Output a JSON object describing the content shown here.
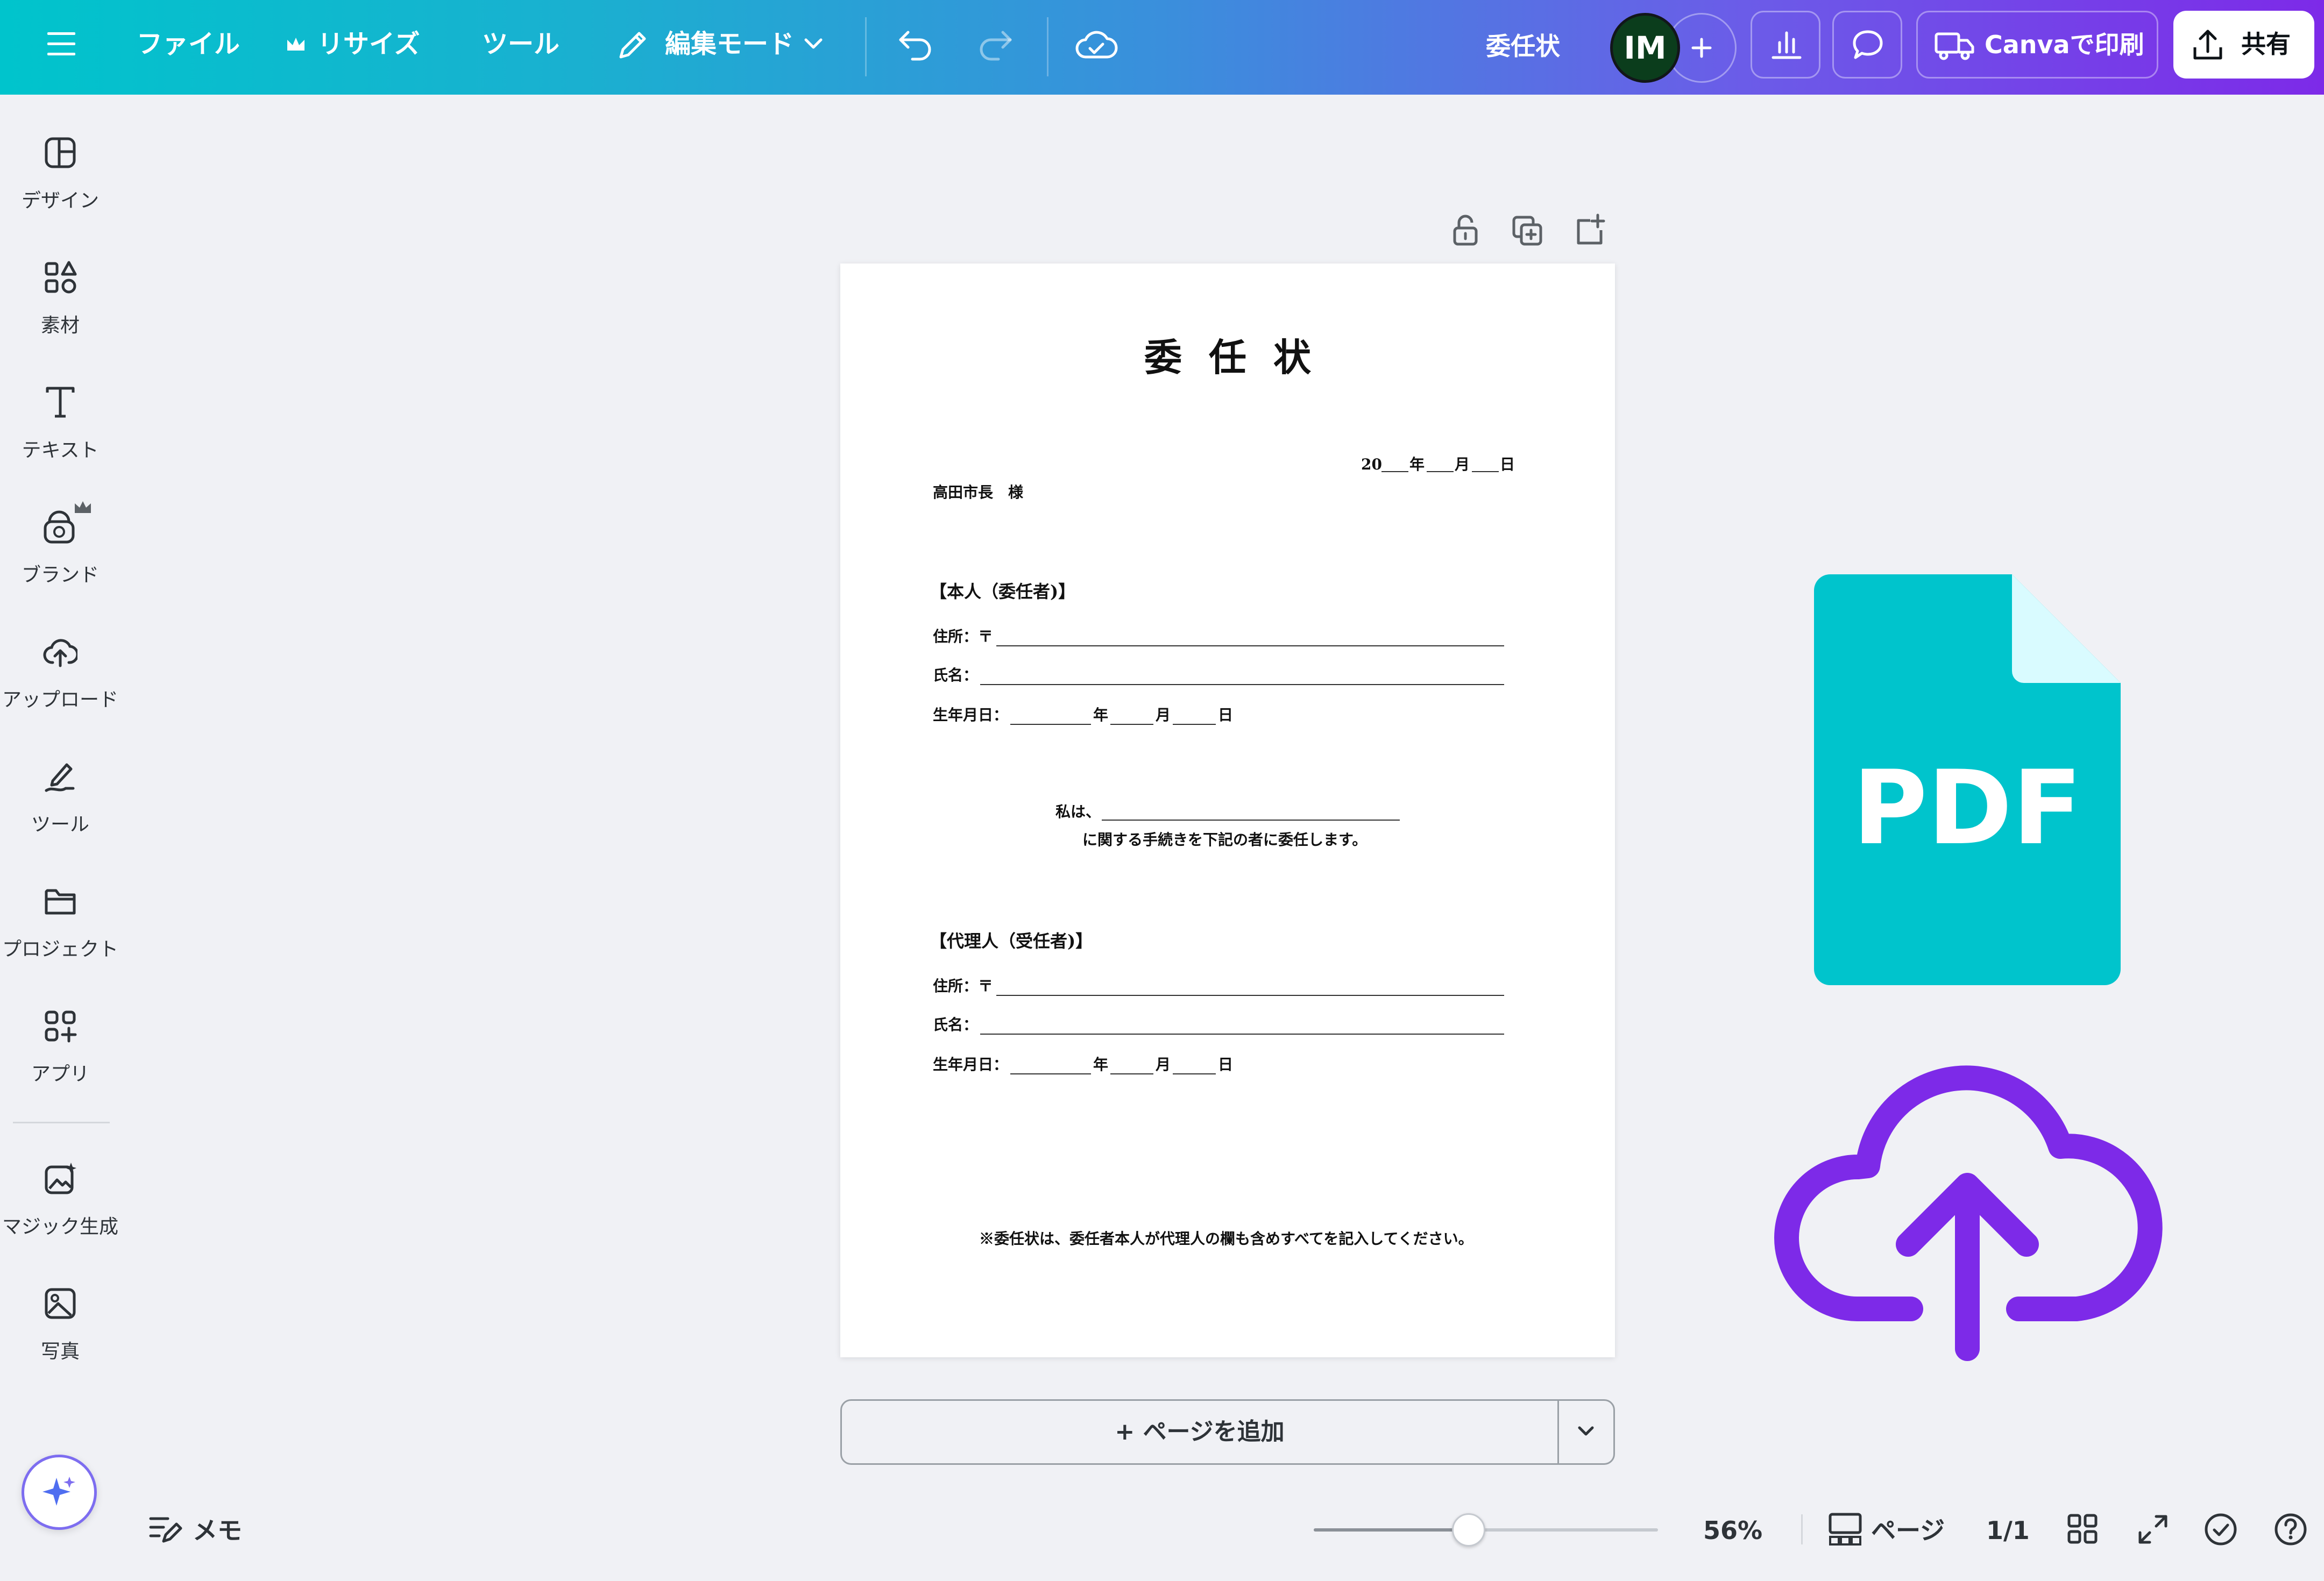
{
  "topbar": {
    "file": "ファイル",
    "resize": "リサイズ",
    "tools": "ツール",
    "edit_mode": "編集モード",
    "doc_title": "委任状",
    "avatar_initials": "IM",
    "print": "Canvaで印刷",
    "share": "共有"
  },
  "sidebar": {
    "items": [
      {
        "label": "デザイン",
        "icon": "design-icon"
      },
      {
        "label": "素材",
        "icon": "elements-icon"
      },
      {
        "label": "テキスト",
        "icon": "text-icon"
      },
      {
        "label": "ブランド",
        "icon": "brand-icon"
      },
      {
        "label": "アップロード",
        "icon": "upload-icon"
      },
      {
        "label": "ツール",
        "icon": "tools-icon"
      },
      {
        "label": "プロジェクト",
        "icon": "projects-icon"
      },
      {
        "label": "アプリ",
        "icon": "apps-icon"
      },
      {
        "label": "マジック生成",
        "icon": "magic-media-icon"
      },
      {
        "label": "写真",
        "icon": "photos-icon"
      }
    ]
  },
  "document": {
    "title": "委任状",
    "date_year_prefix": "20",
    "date_year": "年",
    "date_month": "月",
    "date_day": "日",
    "addressee": "高田市長　様",
    "principal_heading": "【本人（委任者)】",
    "address_label": "住所：〒",
    "name_label": "氏名：",
    "birth_label": "生年月日：",
    "year": "年",
    "month": "月",
    "day": "日",
    "statement_1": "私は、",
    "statement_2": "に関する手続きを下記の者に委任します。",
    "agent_heading": "【代理人（受任者)】",
    "note": "※委任状は、委任者本人が代理人の欄も含めすべてを記入してください。"
  },
  "overlay": {
    "pdf_label": "PDF",
    "pdf_color": "#00c4cc",
    "upload_color": "#7d2ae8"
  },
  "add_page": {
    "label": "+ ページを追加"
  },
  "bottombar": {
    "notes": "メモ",
    "zoom": "56%",
    "zoom_fraction": 0.45,
    "pages": "ページ",
    "page_count": "1/1"
  }
}
